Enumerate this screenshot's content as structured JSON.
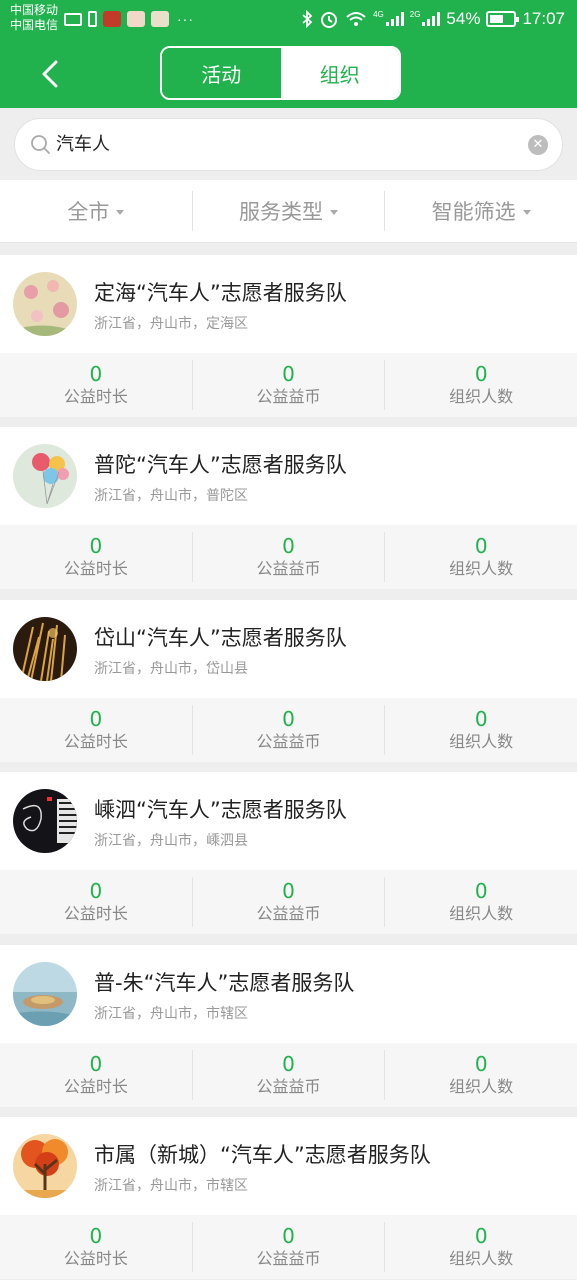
{
  "status_bar": {
    "carrier1": "中国移动",
    "carrier2": "中国电信",
    "more": "···",
    "network_4g": "4G",
    "network_2g": "2G",
    "battery_percent": "54%",
    "time": "17:07"
  },
  "header": {
    "back_icon": "chevron-left-icon",
    "tab_activity": "活动",
    "tab_org": "组织",
    "active_tab": "组织"
  },
  "search": {
    "value": "汽车人"
  },
  "filters": {
    "city": "全市",
    "service_type": "服务类型",
    "smart_filter": "智能筛选"
  },
  "stat_labels": {
    "hours": "公益时长",
    "coins": "公益益币",
    "members": "组织人数"
  },
  "orgs": [
    {
      "name": "定海“汽车人”志愿者服务队",
      "location": "浙江省，舟山市，定海区",
      "hours": "0",
      "coins": "0",
      "members": "0"
    },
    {
      "name": "普陀“汽车人”志愿者服务队",
      "location": "浙江省，舟山市，普陀区",
      "hours": "0",
      "coins": "0",
      "members": "0"
    },
    {
      "name": "岱山“汽车人”志愿者服务队",
      "location": "浙江省，舟山市，岱山县",
      "hours": "0",
      "coins": "0",
      "members": "0"
    },
    {
      "name": "嵊泗“汽车人”志愿者服务队",
      "location": "浙江省，舟山市，嵊泗县",
      "hours": "0",
      "coins": "0",
      "members": "0"
    },
    {
      "name": "普-朱“汽车人”志愿者服务队",
      "location": "浙江省，舟山市，市辖区",
      "hours": "0",
      "coins": "0",
      "members": "0"
    },
    {
      "name": "市属（新城）“汽车人”志愿者服务队",
      "location": "浙江省，舟山市，市辖区",
      "hours": "0",
      "coins": "0",
      "members": "0"
    }
  ],
  "colors": {
    "brand_green": "#21b24d"
  }
}
